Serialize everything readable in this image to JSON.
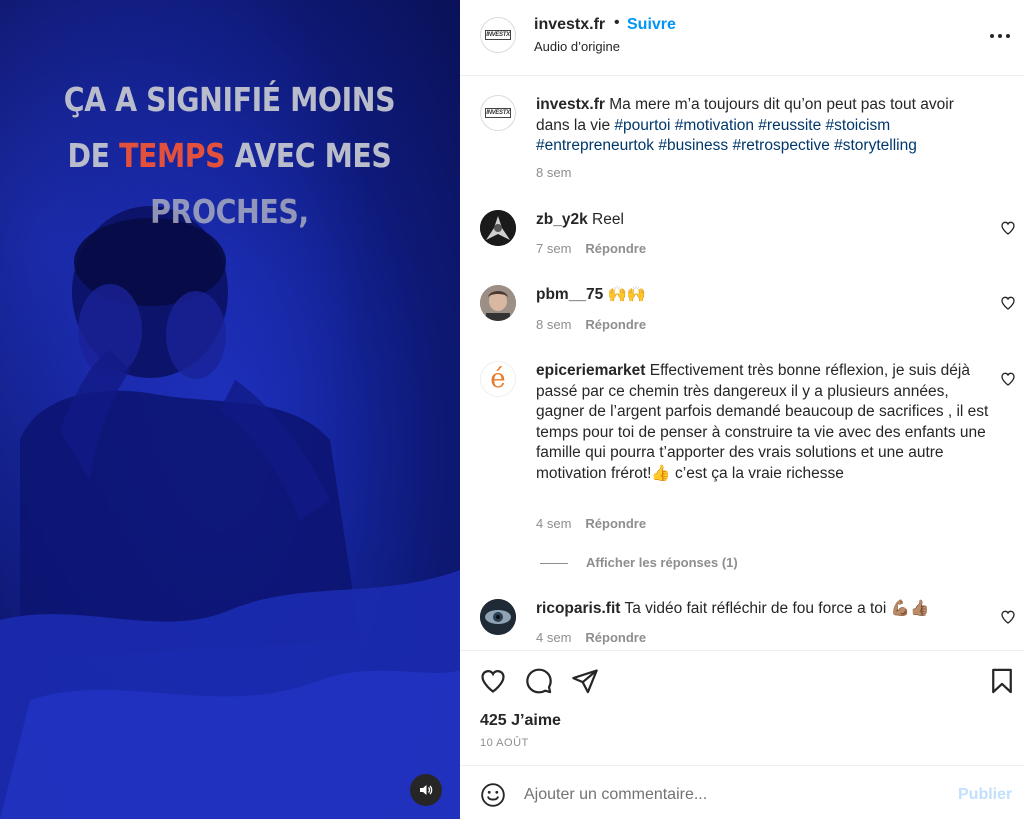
{
  "video": {
    "caption_line1": "ÇA A SIGNIFIÉ MOINS",
    "caption_line2_pre": "DE ",
    "caption_line2_highlight": "TEMPS",
    "caption_line2_post": " AVEC MES",
    "caption_line3": "PROCHES,",
    "sound_icon": "speaker-icon"
  },
  "header": {
    "username": "investx.fr",
    "separator": "•",
    "follow_label": "Suivre",
    "audio_label": "Audio d’origine",
    "avatar_text": "INVESTX"
  },
  "post_caption": {
    "username": "investx.fr",
    "text": "Ma mere m’a toujours dit qu’on peut pas tout avoir dans la vie",
    "hashtags": "#pourtoi #motivation #reussite #stoicism #entrepreneurtok #business #retrospective #storytelling",
    "time": "8 sem"
  },
  "comments": [
    {
      "username": "zb_y2k",
      "text": "Reel",
      "time": "7 sem",
      "reply_label": "Répondre"
    },
    {
      "username": "pbm__75",
      "text": "🙌🙌",
      "time": "8 sem",
      "reply_label": "Répondre"
    },
    {
      "username": "epiceriemarket",
      "text": "Effectivement très bonne réflexion, je suis déjà passé par ce chemin très dangereux il y a plusieurs années, gagner de l’argent parfois demandé beaucoup de sacrifices , il est temps pour toi de penser à construire ta vie avec des enfants une famille qui pourra t’apporter des vrais solutions et une autre motivation frérot!👍 c’est ça la vraie richesse",
      "time": "4 sem",
      "reply_label": "Répondre",
      "avatar_letter": "é"
    },
    {
      "username": "ricoparis.fit",
      "text": "Ta vidéo fait réfléchir de fou force a toi 💪🏽👍🏽",
      "time": "4 sem",
      "reply_label": "Répondre"
    }
  ],
  "view_replies_label": "Afficher les réponses (1)",
  "likes_label": "425 J’aime",
  "date_label": "10 AOÛT",
  "composer": {
    "placeholder": "Ajouter un commentaire...",
    "publish_label": "Publier"
  },
  "colors": {
    "link_blue": "#0095f6",
    "hashtag": "#00376b",
    "meta_gray": "#8e8e8e",
    "caption_red": "#e3513d",
    "video_blue": "#1626a0"
  }
}
